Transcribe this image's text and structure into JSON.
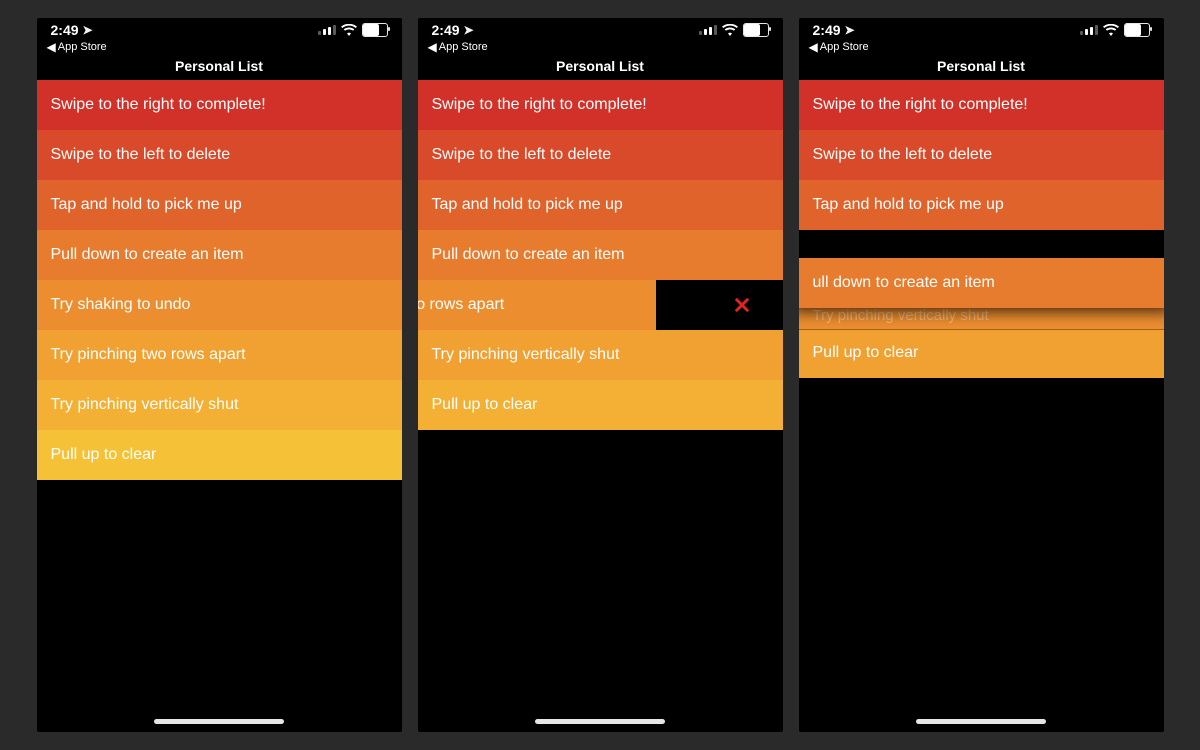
{
  "status": {
    "time": "2:49",
    "back_label": "App Store"
  },
  "header": {
    "title": "Personal List"
  },
  "panelA": {
    "items": [
      "Swipe to the right to complete!",
      "Swipe to the left to delete",
      "Tap and hold to pick me up",
      "Pull down to create an item",
      "Try shaking to undo",
      "Try pinching two rows apart",
      "Try pinching vertically shut",
      "Pull up to clear"
    ]
  },
  "panelB": {
    "items_top": [
      "Swipe to the right to complete!",
      "Swipe to the left to delete",
      "Tap and hold to pick me up",
      "Pull down to create an item"
    ],
    "swiped_item": "ching two rows apart",
    "delete_icon": "close-icon",
    "items_bottom": [
      "Try pinching vertically shut",
      "Pull up to clear"
    ]
  },
  "panelC": {
    "items_top": [
      "Swipe to the right to complete!",
      "Swipe to the left to delete",
      "Tap and hold to pick me up"
    ],
    "floating_item": "ull down to create an item",
    "ghost_item": "Try pinching vertically shut",
    "items_bottom": [
      "Pull up to clear"
    ]
  }
}
